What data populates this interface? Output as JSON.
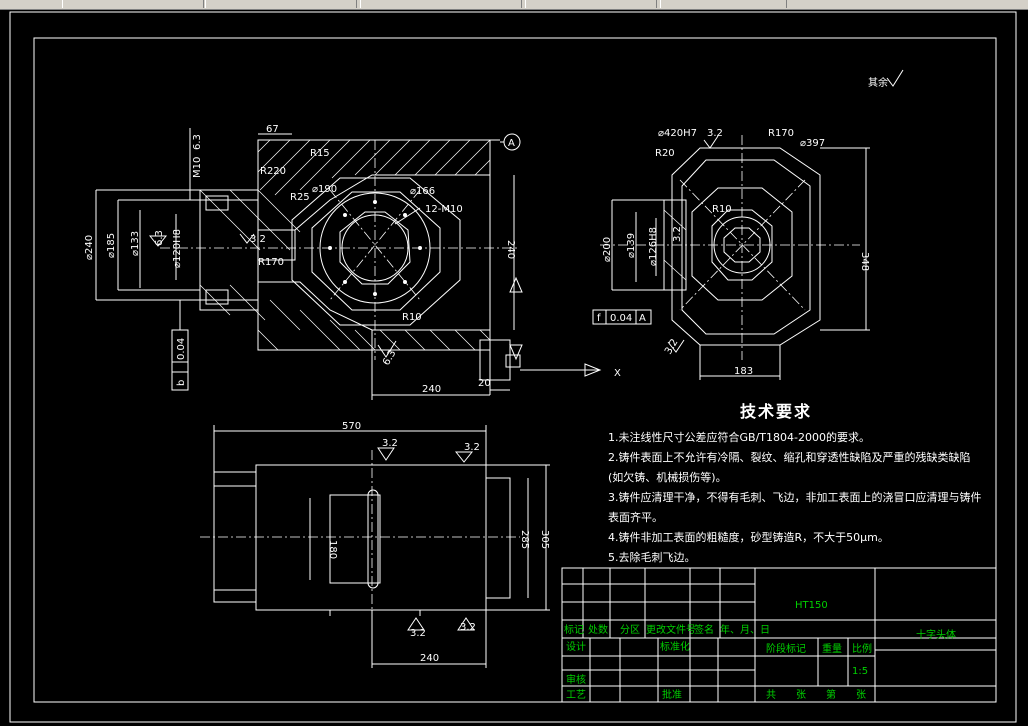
{
  "window": {
    "toolbar_colors": {
      "bar": "#d4d0c8",
      "edge": "#808080"
    }
  },
  "drawing": {
    "background": "#000000",
    "line_color": "#ffffff",
    "title_block_color": "#00c800",
    "roughness_global": "其余",
    "front_view": {
      "dims": {
        "d67": "67",
        "r15": "R15",
        "r220": "R220",
        "r25": "R25",
        "d190": "⌀190",
        "d166": "⌀166",
        "m10_12": "12-M10",
        "m10": "M10",
        "ra63_top": "6.3",
        "d240": "⌀240",
        "d185": "⌀185",
        "d133": "⌀133",
        "d120h8": "⌀120H8",
        "ra63_left": "6.3",
        "ra32_left": "3.2",
        "r170": "R170",
        "r10": "R10",
        "len240_v": "240",
        "ra63_bottom": "6.3",
        "len240_h": "240",
        "len20": "20",
        "datum_a": "A",
        "tol_symbol": "b",
        "tol_value": "0.04",
        "tol_datum": "A",
        "axis_x": "X"
      }
    },
    "side_view": {
      "dims": {
        "d420h7": "⌀420H7",
        "ra32": "3.2",
        "r170": "R170",
        "d397": "⌀397",
        "r20": "R20",
        "r10": "R10",
        "d200": "⌀200",
        "d139": "⌀139",
        "d126h8": "⌀126H8",
        "ra32_b": "3.2",
        "ra32_c": "3.2",
        "h348": "348",
        "w183": "183",
        "tol_symbol": "f",
        "tol_value": "0.04",
        "tol_datum": "A"
      }
    },
    "top_view": {
      "dims": {
        "len570": "570",
        "ra32_a": "3.2",
        "ra32_b": "3.2",
        "d180": "180",
        "d285": "285",
        "d305": "305",
        "ra32_c": "3.2",
        "ra32_d": "3.2",
        "len240": "240"
      }
    },
    "tech_requirements": {
      "title": "技术要求",
      "items": [
        "1.未注线性尺寸公差应符合GB/T1804-2000的要求。",
        "2.铸件表面上不允许有冷隔、裂纹、缩孔和穿透性缺陷及严重的残缺类缺陷",
        "(如欠铸、机械损伤等)。",
        "3.铸件应清理干净，不得有毛刺、飞边，非加工表面上的浇冒口应清理与铸件",
        "表面齐平。",
        "4.铸件非加工表面的粗糙度，砂型铸造R，不大于50μm。",
        "5.去除毛刺飞边。"
      ]
    },
    "title_block": {
      "material": "HT150",
      "part_name": "十字头体",
      "labels": {
        "mark": "标记",
        "count": "处数",
        "zone": "分区",
        "change_doc": "更改文件号",
        "sign": "签名",
        "date": "年、月、日",
        "design": "设计",
        "standardize": "标准化",
        "stage_mark": "阶段标记",
        "weight": "重量",
        "scale": "比例",
        "scale_value": "1:5",
        "review": "审核",
        "process": "工艺",
        "approve": "批准",
        "total_sheets": "共",
        "sheets": "张",
        "sheet_no": "第",
        "sheet": "张"
      }
    }
  }
}
